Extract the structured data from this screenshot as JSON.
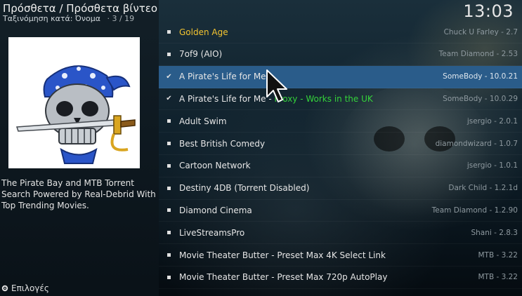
{
  "header": {
    "title": "Πρόσθετα / Πρόσθετα βίντεο",
    "sort": "Ταξινόμηση κατά: Όνομα",
    "count": "3 / 19",
    "clock": "13:03"
  },
  "info": {
    "thumbnail_icon": "pirate-skull-icon",
    "description": "The Pirate Bay and MTB Torrent Search Powered by Real-Debrid With Top Trending Movies."
  },
  "footer": {
    "options_label": "Επιλογές"
  },
  "colors": {
    "selected": "#2a5c8a",
    "gold": "#f4c430",
    "green": "#34d33a"
  },
  "addons": [
    {
      "name": "Golden Age",
      "author": "Chuck U Farley - 2.7",
      "mark": "dot",
      "style": "gold"
    },
    {
      "name": "7of9 (AIO)",
      "author": "Team Diamond - 2.53",
      "mark": "dot"
    },
    {
      "name": "A Pirate's Life for Me",
      "author": "SomeBody - 10.0.21",
      "mark": "check",
      "selected": true
    },
    {
      "name": "A Pirate's Life for Me - ",
      "name_suffix": "Proxy - Works in the UK",
      "author": "SomeBody - 10.0.29",
      "mark": "check"
    },
    {
      "name": "Adult Swim",
      "author": "jsergio - 2.0.1",
      "mark": "dot"
    },
    {
      "name": "Best British Comedy",
      "author": "diamondwizard - 1.0.7",
      "mark": "dot"
    },
    {
      "name": "Cartoon Network",
      "author": "jsergio - 1.0.1",
      "mark": "dot"
    },
    {
      "name": "Destiny 4DB (Torrent Disabled)",
      "author": "Dark Child - 1.2.1d",
      "mark": "dot"
    },
    {
      "name": "Diamond Cinema",
      "author": "Team Diamond - 1.2.90",
      "mark": "dot"
    },
    {
      "name": "LiveStreamsPro",
      "author": "Shani - 2.8.3",
      "mark": "dot"
    },
    {
      "name": "Movie Theater Butter - Preset Max 4K Select Link",
      "author": "MTB - 3.22",
      "mark": "dot"
    },
    {
      "name": "Movie Theater Butter - Preset Max 720p AutoPlay",
      "author": "MTB - 3.22",
      "mark": "dot"
    }
  ]
}
